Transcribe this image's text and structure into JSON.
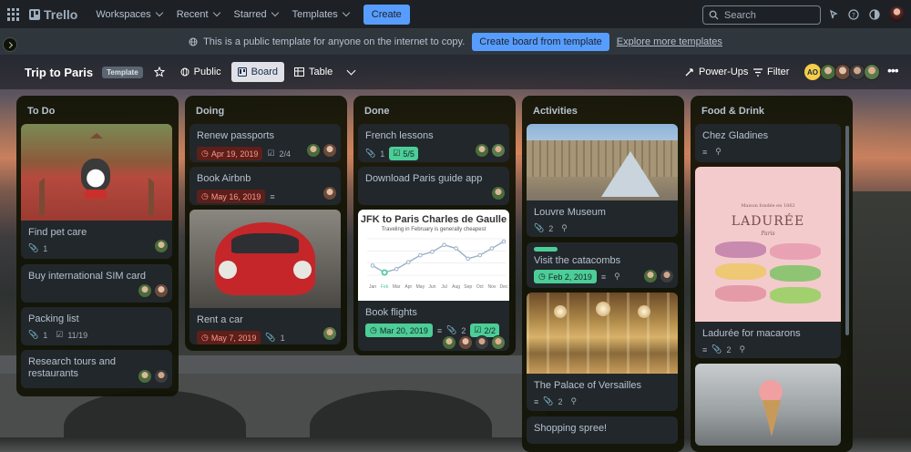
{
  "nav": {
    "logo": "Trello",
    "workspaces": "Workspaces",
    "recent": "Recent",
    "starred": "Starred",
    "templates": "Templates",
    "create": "Create",
    "search_placeholder": "Search"
  },
  "banner": {
    "text": "This is a public template for anyone on the internet to copy.",
    "button": "Create board from template",
    "link": "Explore more templates"
  },
  "board": {
    "title": "Trip to Paris",
    "badge": "Template",
    "visibility": "Public",
    "view_board": "Board",
    "view_table": "Table",
    "powerups": "Power-Ups",
    "filter": "Filter",
    "member_initials": "AO"
  },
  "lists": [
    {
      "title": "To Do",
      "cards": [
        {
          "title": "Find pet care",
          "attachments": "1"
        },
        {
          "title": "Buy international SIM card"
        },
        {
          "title": "Packing list",
          "attachments": "1",
          "checklist": "11/19"
        },
        {
          "title": "Research tours and restaurants"
        }
      ]
    },
    {
      "title": "Doing",
      "cards": [
        {
          "title": "Renew passports",
          "date": "Apr 19, 2019",
          "checklist": "2/4"
        },
        {
          "title": "Book Airbnb",
          "date": "May 16, 2019"
        },
        {
          "title": "Rent a car",
          "date": "May 7, 2019",
          "attachments": "1"
        }
      ]
    },
    {
      "title": "Done",
      "cards": [
        {
          "title": "French lessons",
          "attachments": "1",
          "checklist": "5/5"
        },
        {
          "title": "Download Paris guide app"
        },
        {
          "title": "Book flights",
          "date": "Mar 20, 2019",
          "attachments": "2",
          "checklist": "2/2"
        }
      ]
    },
    {
      "title": "Activities",
      "cards": [
        {
          "title": "Louvre Museum",
          "attachments": "2"
        },
        {
          "title": "Visit the catacombs",
          "date": "Feb 2, 2019"
        },
        {
          "title": "The Palace of Versailles",
          "attachments": "2"
        },
        {
          "title": "Shopping spree!"
        }
      ]
    },
    {
      "title": "Food & Drink",
      "cards": [
        {
          "title": "Chez Gladines"
        },
        {
          "title": "Ladurée for macarons",
          "attachments": "2"
        }
      ]
    }
  ],
  "flight_chart": {
    "title": "JFK to Paris Charles de Gaulle",
    "subtitle": "Traveling in February is generally cheapest",
    "months": [
      "Jan",
      "Feb",
      "Mar",
      "Apr",
      "May",
      "Jun",
      "Jul",
      "Aug",
      "Sep",
      "Oct",
      "Nov",
      "Dec"
    ],
    "values": [
      5,
      3,
      4,
      6,
      8,
      9,
      11,
      10,
      7,
      8,
      10,
      12
    ]
  },
  "laduree": {
    "founded": "Maison fondée en 1862",
    "brand": "LADURÉE",
    "city": "Paris"
  },
  "colors": {
    "accent": "#579dff",
    "green": "#4bce97",
    "red_date_bg": "#5d1f1a",
    "card": "#22272b"
  }
}
